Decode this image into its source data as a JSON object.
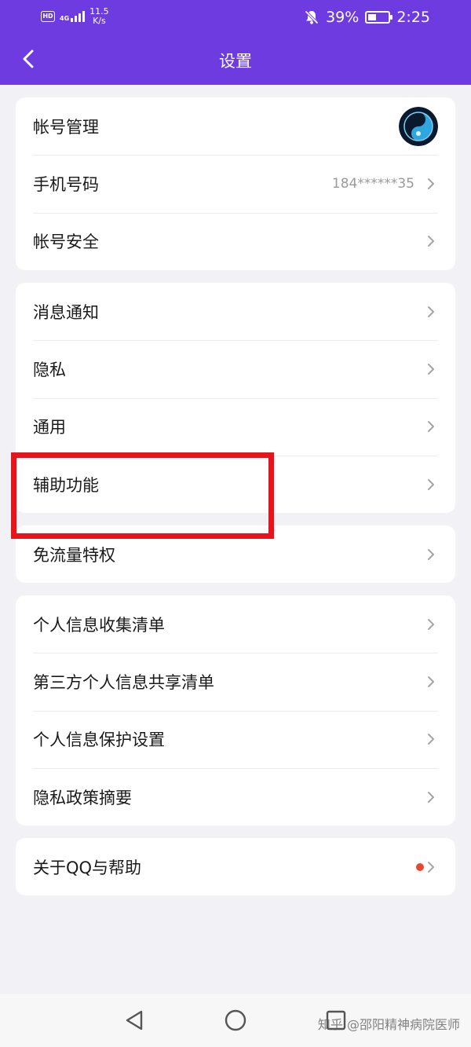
{
  "status_bar": {
    "hd_badge": "HD",
    "network": "4G",
    "speed_value": "11.5",
    "speed_unit": "K/s",
    "battery_level": 0.39,
    "battery_percent": "39%",
    "time": "2:25"
  },
  "header": {
    "title": "设置"
  },
  "groups": [
    {
      "items": [
        {
          "label": "帐号管理"
        },
        {
          "label": "手机号码",
          "value": "184******35"
        },
        {
          "label": "帐号安全"
        }
      ]
    },
    {
      "items": [
        {
          "label": "消息通知"
        },
        {
          "label": "隐私"
        },
        {
          "label": "通用"
        },
        {
          "label": "辅助功能"
        }
      ]
    },
    {
      "items": [
        {
          "label": "免流量特权"
        }
      ]
    },
    {
      "items": [
        {
          "label": "个人信息收集清单"
        },
        {
          "label": "第三方个人信息共享清单"
        },
        {
          "label": "个人信息保护设置"
        },
        {
          "label": "隐私政策摘要"
        }
      ]
    },
    {
      "items": [
        {
          "label": "关于QQ与帮助"
        }
      ]
    }
  ],
  "watermark": "知乎 @邵阳精神病院医师",
  "colors": {
    "accent": "#6e3be0",
    "highlight": "#e8141c",
    "badge": "#e8482f"
  }
}
